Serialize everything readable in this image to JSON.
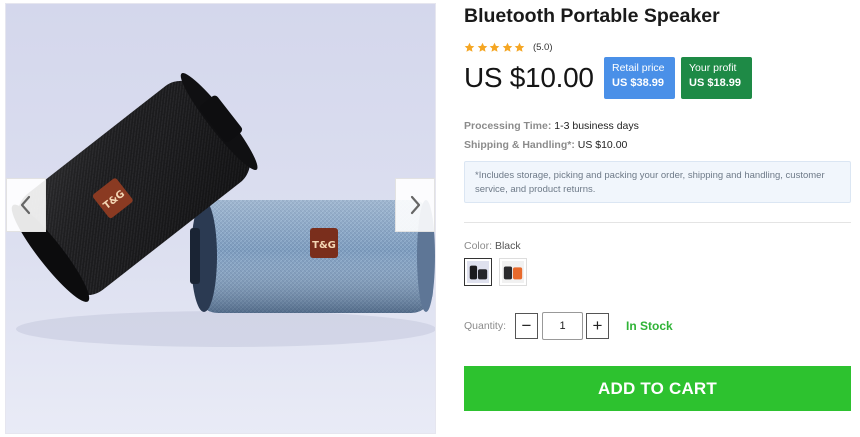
{
  "product": {
    "title": "Bluetooth Portable Speaker",
    "rating": {
      "stars": 5,
      "text": "(5.0)",
      "star_color": "#f5a623"
    },
    "price": "US $10.00",
    "retail": {
      "label": "Retail price",
      "value": "US $38.99",
      "color": "#4a90e8"
    },
    "profit": {
      "label": "Your profit",
      "value": "US $18.99",
      "color": "#1e8a46"
    },
    "processing": {
      "label": "Processing Time:",
      "value": "1-3 business days"
    },
    "shipping": {
      "label": "Shipping & Handling*:",
      "value": "US $10.00"
    },
    "notice": "*Includes storage, picking and packing your order, shipping and handling, customer service, and product returns."
  },
  "gallery": {
    "icons": {
      "prev": "chevron-left-icon",
      "next": "chevron-right-icon"
    },
    "logo_text": "T&G"
  },
  "variants": {
    "label": "Color:",
    "selected": "Black",
    "options": [
      {
        "name": "Black",
        "selected": true
      },
      {
        "name": "Orange",
        "selected": false
      }
    ]
  },
  "quantity": {
    "label": "Quantity:",
    "value": "1",
    "minus": "−",
    "plus": "+"
  },
  "stock": {
    "text": "In Stock",
    "color": "#2fb336"
  },
  "cart": {
    "label": "ADD TO CART",
    "color": "#2dc22f"
  }
}
